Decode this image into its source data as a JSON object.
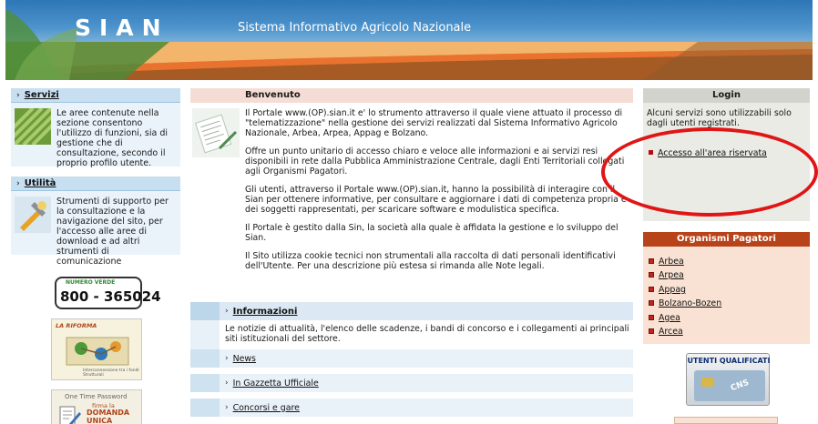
{
  "header": {
    "logo": "SIAN",
    "title": "Sistema Informativo Agricolo Nazionale"
  },
  "left": {
    "servizi": {
      "title": "Servizi",
      "text": "Le aree contenute nella sezione consentono l'utilizzo di funzioni, sia di gestione che di consultazione, secondo il proprio profilo utente."
    },
    "utilita": {
      "title": "Utilità",
      "text": "Strumenti di supporto per la consultazione e la navigazione del sito, per l'accesso alle aree di download e ad altri strumenti di comunicazione"
    },
    "numero_verde": {
      "label": "NUMERO VERDE",
      "number": "800 - 365024"
    },
    "riforma": {
      "title": "LA RIFORMA",
      "caption": "Interconnessione tra i fondi Strutturali"
    },
    "otp": {
      "title": "One Time Password",
      "line1": "firma la",
      "line2": "DOMANDA",
      "line3": "UNICA"
    }
  },
  "center": {
    "benvenuto": {
      "title": "Benvenuto",
      "paragraphs": [
        "Il Portale www.(OP).sian.it e' lo strumento attraverso il quale viene attuato il processo di \"telematizzazione\" nella gestione dei servizi realizzati dal Sistema Informativo Agricolo Nazionale, Arbea, Arpea, Appag e Bolzano.",
        "Offre un punto unitario di accesso chiaro e veloce alle informazioni e ai servizi resi disponibili in rete dalla Pubblica Amministrazione Centrale, dagli Enti Territoriali collegati agli Organismi Pagatori.",
        "Gli utenti, attraverso il Portale www.(OP).sian.it, hanno la possibilità di interagire con il Sian per ottenere informative, per consultare e aggiornare i dati di competenza propria e dei soggetti rappresentati, per scaricare software e modulistica specifica.",
        "Il Portale è gestito dalla Sin, la società alla quale è affidata la gestione e lo sviluppo del Sian.",
        "Il Sito utilizza cookie tecnici non strumentali alla raccolta di dati personali identificativi dell'Utente. Per una descrizione più estesa si rimanda alle Note legali."
      ]
    },
    "informazioni": {
      "title": "Informazioni",
      "text": "Le notizie di attualità, l'elenco delle scadenze, i bandi di concorso e i collegamenti ai principali siti istituzionali del settore.",
      "links": [
        "News",
        "In Gazzetta Ufficiale",
        "Concorsi e gare"
      ]
    }
  },
  "right": {
    "login": {
      "title": "Login",
      "text": "Alcuni servizi sono utilizzabili solo dagli utenti registrati.",
      "link": "Accesso all'area riservata"
    },
    "organismi": {
      "title": "Organismi Pagatori",
      "items": [
        "Arbea",
        "Arpea",
        "Appag",
        "Bolzano-Bozen",
        "Agea",
        "Arcea"
      ]
    },
    "utenti_qualificati": {
      "title": "UTENTI QUALIFICATI",
      "badge": "CNS"
    }
  },
  "colors": {
    "annotation": "#e01515",
    "accent_orange": "#b8431a",
    "accent_blue": "#2d77b6"
  }
}
